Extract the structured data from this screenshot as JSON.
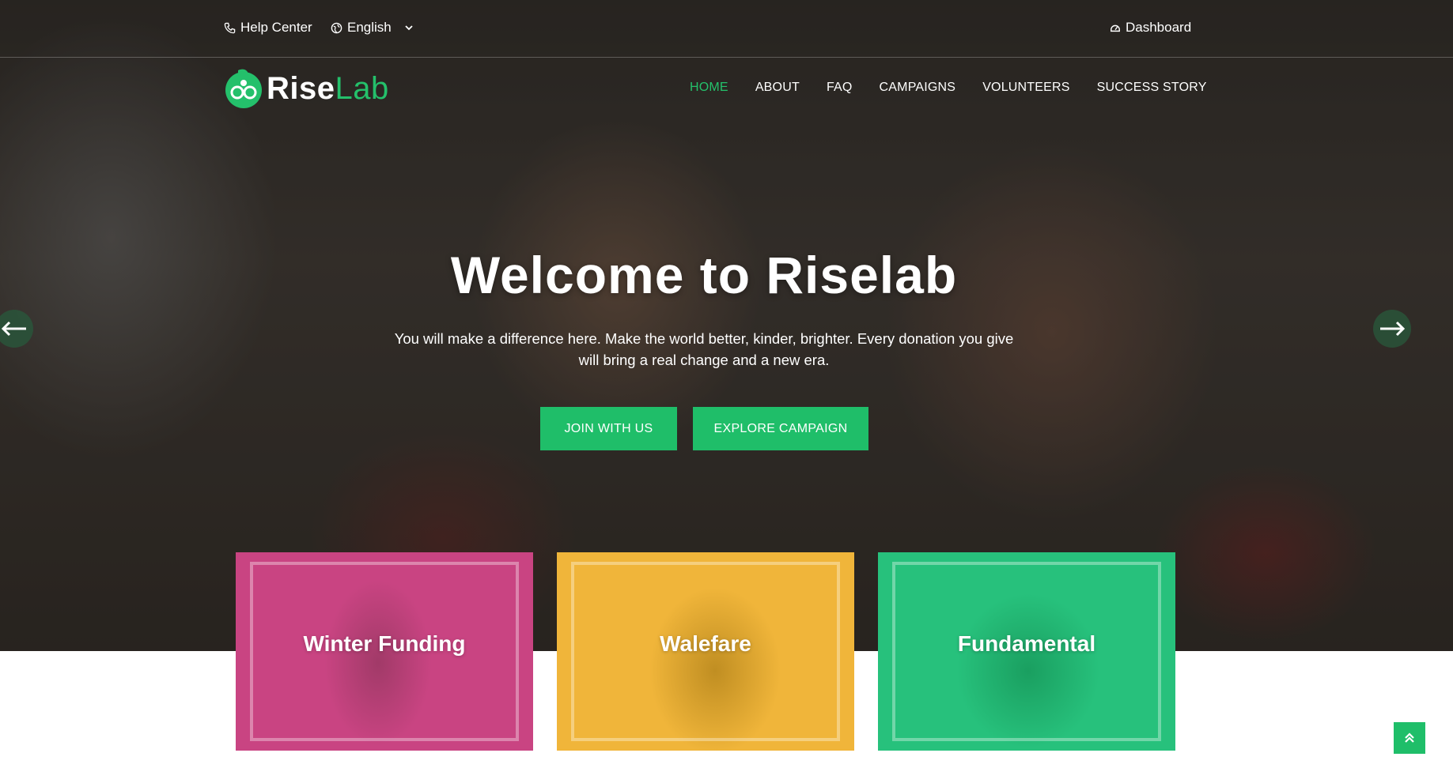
{
  "topbar": {
    "help_label": "Help Center",
    "language_label": "English",
    "dashboard_label": "Dashboard"
  },
  "brand": {
    "name_part1": "Rise",
    "name_part2": "Lab",
    "accent_color": "#24c06b"
  },
  "nav": {
    "items": [
      {
        "label": "HOME",
        "active": true
      },
      {
        "label": "ABOUT",
        "active": false
      },
      {
        "label": "FAQ",
        "active": false
      },
      {
        "label": "CAMPAIGNS",
        "active": false
      },
      {
        "label": "VOLUNTEERS",
        "active": false
      },
      {
        "label": "SUCCESS STORY",
        "active": false
      }
    ]
  },
  "hero": {
    "title": "Welcome to Riselab",
    "subtitle": "You will make a difference here. Make the world better, kinder, brighter. Every donation you give will bring a real change and a new era.",
    "primary_button": "JOIN WITH US",
    "secondary_button": "EXPLORE CAMPAIGN",
    "prev_icon": "arrow-left-icon",
    "next_icon": "arrow-right-icon"
  },
  "cards": [
    {
      "label": "Winter Funding",
      "color": "#c94482"
    },
    {
      "label": "Walefare",
      "color": "#f0b53a"
    },
    {
      "label": "Fundamental",
      "color": "#27c17c"
    }
  ],
  "scroll_top_icon": "double-chevron-up-icon"
}
